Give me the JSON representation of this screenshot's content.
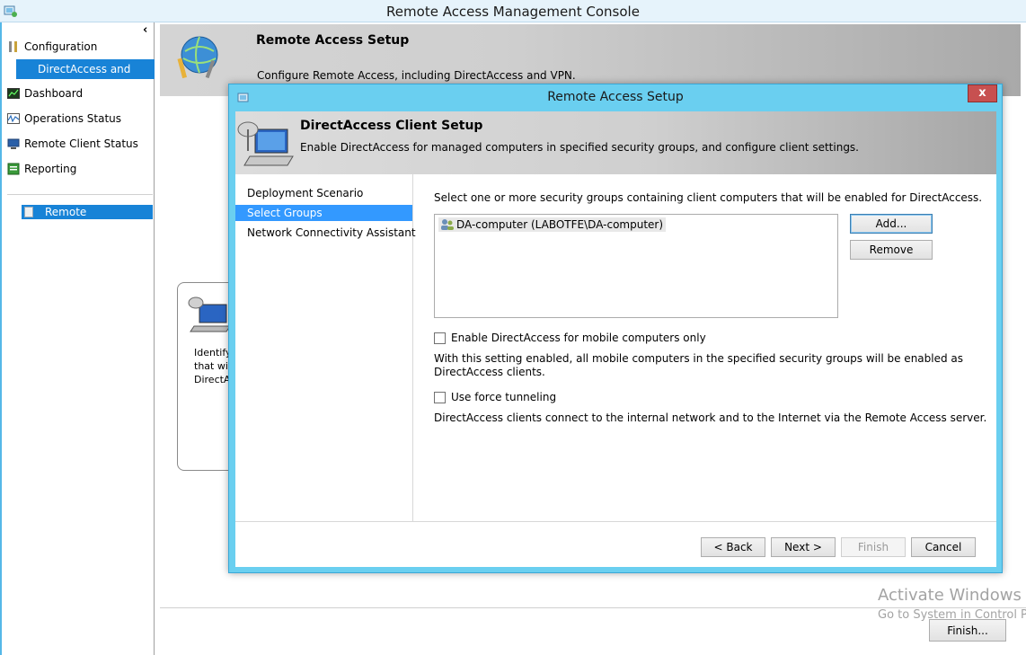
{
  "window": {
    "title": "Remote Access Management Console"
  },
  "nav": {
    "collapse_glyph": "‹",
    "configuration": "Configuration",
    "directaccess_vpn": "DirectAccess and VPN",
    "dashboard": "Dashboard",
    "operations_status": "Operations Status",
    "remote_client_status": "Remote Client Status",
    "reporting": "Reporting",
    "remote": "Remote"
  },
  "main": {
    "header_title": "Remote Access Setup",
    "header_desc": "Configure Remote Access, including DirectAccess and VPN.",
    "card_lines": [
      "Identify",
      "that wi",
      "DirectA"
    ],
    "finish_button": "Finish..."
  },
  "watermark": {
    "line1": "Activate Windows",
    "line2": "Go to System in Control P"
  },
  "dialog": {
    "title": "Remote Access Setup",
    "close_label": "x",
    "header_title": "DirectAccess Client Setup",
    "header_desc": "Enable DirectAccess for managed computers in specified security groups, and configure client settings.",
    "steps": [
      "Deployment Scenario",
      "Select Groups",
      "Network Connectivity Assistant"
    ],
    "selected_step": "Select Groups",
    "intro": "Select one or more security groups containing client computers that will be enabled for DirectAccess.",
    "groups": [
      "DA-computer (LABOTFE\\DA-computer)"
    ],
    "add_button": "Add...",
    "remove_button": "Remove",
    "mobile_only_label": "Enable DirectAccess for mobile computers only",
    "mobile_only_checked": false,
    "mobile_note_1": "With this setting enabled, all mobile computers in the specified security groups will be enabled as",
    "mobile_note_2": "DirectAccess clients.",
    "force_tunnel_label": "Use force tunneling",
    "force_tunnel_checked": false,
    "force_tunnel_note": "DirectAccess clients connect to the internal network and to the Internet via the Remote Access server.",
    "back_button": "< Back",
    "next_button": "Next >",
    "finish_button": "Finish",
    "cancel_button": "Cancel"
  },
  "colors": {
    "accent": "#1883d7",
    "dialog_frame": "#6acff0",
    "close_button": "#c75050"
  }
}
